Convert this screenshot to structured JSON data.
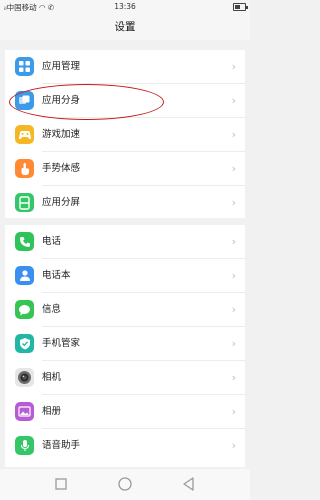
{
  "status_bar": {
    "signal_label": "📶",
    "carrier": "中国移动",
    "icons": "◠ ✆",
    "time": "13:36",
    "battery_level": 0.6
  },
  "header": {
    "title": "设置"
  },
  "group1": {
    "items": [
      {
        "label": "应用管理",
        "icon": "app-grid-icon",
        "color": "#3b9be8"
      },
      {
        "label": "应用分身",
        "icon": "app-clone-icon",
        "color": "#3b9be8"
      },
      {
        "label": "游戏加速",
        "icon": "gamepad-icon",
        "color": "#f5b723"
      },
      {
        "label": "手势体感",
        "icon": "hand-gesture-icon",
        "color": "#ff8a33"
      },
      {
        "label": "应用分屏",
        "icon": "split-screen-icon",
        "color": "#35c667"
      }
    ]
  },
  "group2": {
    "items": [
      {
        "label": "电话",
        "icon": "phone-icon",
        "color": "#2fc35a"
      },
      {
        "label": "电话本",
        "icon": "contacts-icon",
        "color": "#3a8ff0"
      },
      {
        "label": "信息",
        "icon": "message-icon",
        "color": "#36c453"
      },
      {
        "label": "手机管家",
        "icon": "shield-icon",
        "color": "#22b7a4"
      },
      {
        "label": "相机",
        "icon": "camera-icon",
        "color": "#7a7a7a"
      },
      {
        "label": "相册",
        "icon": "gallery-icon",
        "color": "#b75bd6"
      },
      {
        "label": "语音助手",
        "icon": "microphone-icon",
        "color": "#35c667"
      }
    ]
  },
  "chevron": "›",
  "nav": {
    "recent_icon": "square-icon",
    "home_icon": "circle-icon",
    "back_icon": "triangle-back-icon"
  }
}
